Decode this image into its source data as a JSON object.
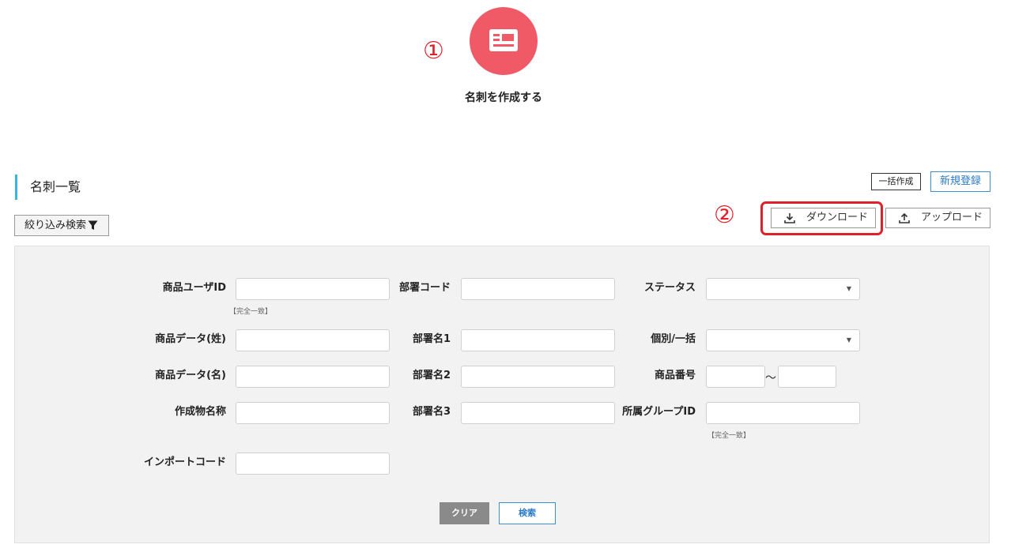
{
  "annotations": {
    "one": "①",
    "two": "②"
  },
  "create": {
    "label": "名刺を作成する",
    "icon": "business-card-icon",
    "color": "#f05a67"
  },
  "list": {
    "title": "名刺一覧",
    "bulk_create": "一括作成",
    "new_register": "新規登録",
    "filter_search": "絞り込み検索",
    "download": "ダウンロード",
    "upload": "アップロード",
    "accent_color": "#3fb5d8",
    "highlight_color": "#e0202a"
  },
  "form": {
    "product_user_id": "商品ユーザID",
    "exact_match_hint": "【完全一致】",
    "dept_code": "部署コード",
    "status": "ステータス",
    "product_data_surname": "商品データ(姓)",
    "dept_name1": "部署名1",
    "individual_bulk": "個別/一括",
    "product_data_name": "商品データ(名)",
    "dept_name2": "部署名2",
    "product_number": "商品番号",
    "range_separator": "〜",
    "creation_name": "作成物名称",
    "dept_name3": "部署名3",
    "group_id": "所属グループID",
    "group_hint": "【完全一致】",
    "import_code": "インポートコード",
    "clear": "クリア",
    "search": "検索"
  }
}
